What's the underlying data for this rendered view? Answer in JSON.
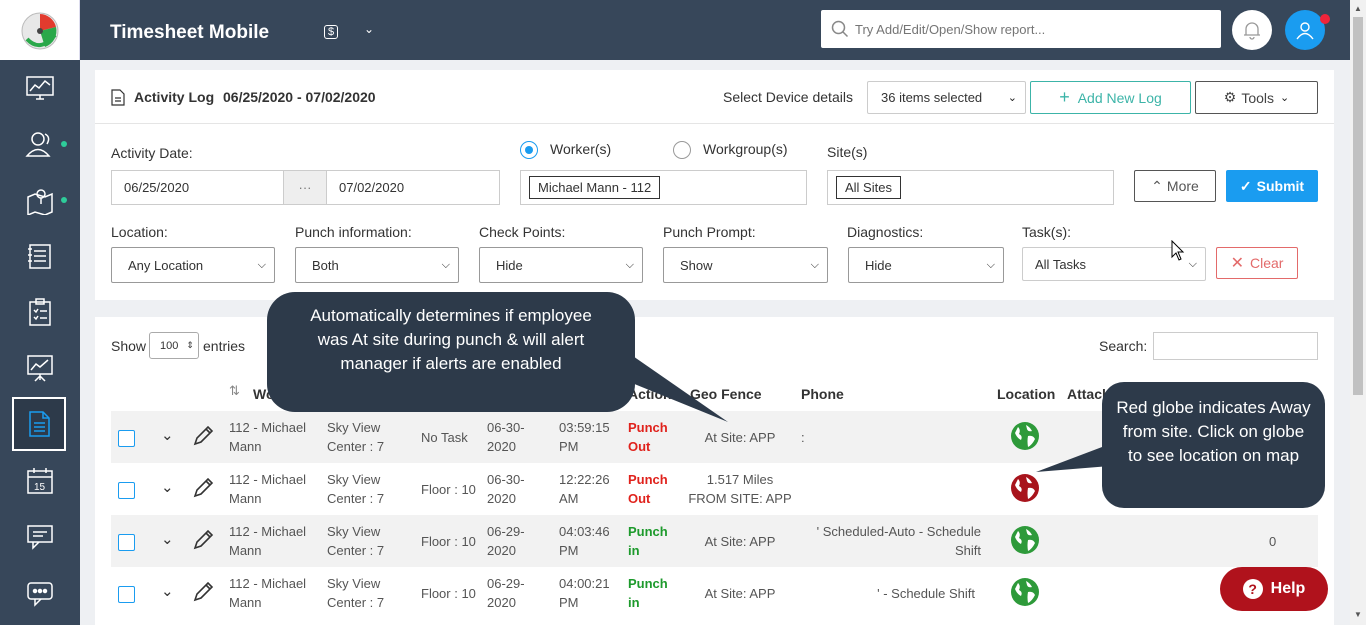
{
  "header": {
    "app_title": "Timesheet Mobile",
    "currency_symbol": "$",
    "search_placeholder": "Try Add/Edit/Open/Show report..."
  },
  "activity": {
    "title": "Activity Log",
    "date_range": "06/25/2020 - 07/02/2020",
    "device_label": "Select Device details",
    "device_selected": "36 items selected",
    "add_label": "Add New Log",
    "tools_label": "Tools"
  },
  "filters": {
    "activity_date_label": "Activity Date:",
    "date_from": "06/25/2020",
    "date_sep": "···",
    "date_to": "07/02/2020",
    "worker_label": "Worker(s)",
    "workgroup_label": "Workgroup(s)",
    "worker_value": "Michael Mann - 112",
    "site_label": "Site(s)",
    "site_value": "All Sites",
    "more_label": "More",
    "submit_label": "Submit",
    "location_label": "Location:",
    "location_value": "Any Location",
    "punch_label": "Punch information:",
    "punch_value": "Both",
    "checkpoints_label": "Check Points:",
    "checkpoints_value": "Hide",
    "prompt_label": "Punch Prompt:",
    "prompt_value": "Show",
    "diagnostics_label": "Diagnostics:",
    "diagnostics_value": "Hide",
    "tasks_label": "Task(s):",
    "tasks_value": "All Tasks",
    "clear_label": "Clear"
  },
  "table": {
    "show_label": "Show",
    "entries_value": "100",
    "entries_label": "entries",
    "search_label": "Search:",
    "columns": {
      "worker": "Wo",
      "action": "Action",
      "geofence": "Geo Fence",
      "phone": "Phone",
      "location": "Location",
      "attach": "Attach"
    },
    "rows": [
      {
        "worker": "112 - Michael Mann",
        "site": "Sky View Center : 7",
        "task": "No Task",
        "date": "06-30-2020",
        "time": "03:59:15 PM",
        "action": "Punch Out",
        "geofence": "At Site: APP",
        "phone": ":",
        "extra": ""
      },
      {
        "worker": "112 - Michael Mann",
        "site": "Sky View Center : 7",
        "task": "Floor : 10",
        "date": "06-30-2020",
        "time": "12:22:26 AM",
        "action": "Punch Out",
        "geofence": "1.517 Miles FROM SITE: APP",
        "phone": "",
        "extra": ""
      },
      {
        "worker": "112 - Michael Mann",
        "site": "Sky View Center : 7",
        "task": "Floor : 10",
        "date": "06-29-2020",
        "time": "04:03:46 PM",
        "action": "Punch in",
        "geofence": "At Site: APP",
        "phone": "' Scheduled-Auto - Schedule Shift",
        "extra": "0"
      },
      {
        "worker": "112 - Michael Mann",
        "site": "Sky View Center : 7",
        "task": "Floor : 10",
        "date": "06-29-2020",
        "time": "04:00:21 PM",
        "action": "Punch in",
        "geofence": "At Site: APP",
        "phone": "' - Schedule Shift",
        "extra": ""
      }
    ]
  },
  "callouts": {
    "geofence": "Automatically determines if employee was At site during punch & will alert manager if alerts are enabled",
    "globe": "Red globe indicates Away from site. Click on globe to see location on map"
  },
  "help_label": "Help",
  "colors": {
    "sidebar": "#37475a",
    "accent": "#1a9cf0",
    "punch_out": "#e0221c",
    "punch_in": "#1d9a2c",
    "help": "#b0121c"
  }
}
